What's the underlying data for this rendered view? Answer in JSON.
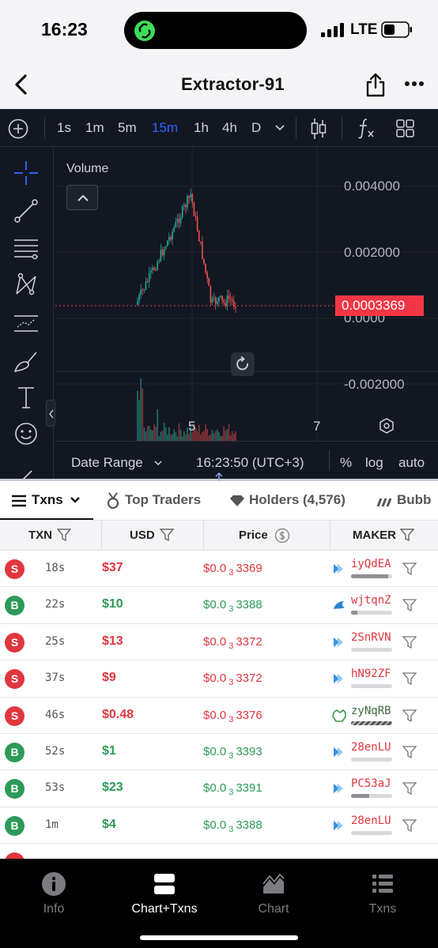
{
  "status": {
    "time": "16:23",
    "network": "LTE"
  },
  "header": {
    "title": "Extractor-91"
  },
  "toolbar": {
    "intervals": [
      "1s",
      "1m",
      "5m",
      "15m",
      "1h",
      "4h",
      "D"
    ],
    "active_interval": "15m"
  },
  "chart": {
    "panel_label": "Volume",
    "y_labels": [
      "0.004000",
      "0.002000",
      "0.0000",
      "-0.002000"
    ],
    "last_price": "0.0003369",
    "x_labels": [
      "5",
      "7"
    ],
    "date_range_label": "Date Range",
    "clock": "16:23:50 (UTC+3)",
    "percent_label": "%",
    "log_label": "log",
    "auto_label": "auto",
    "colors": {
      "up": "#26a69a",
      "down": "#ef5350",
      "price_line": "#f23645"
    }
  },
  "tabs": [
    {
      "label": "Txns"
    },
    {
      "label": "Top Traders"
    },
    {
      "label": "Holders (4,576)"
    },
    {
      "label": "Bubb"
    }
  ],
  "table": {
    "headers": {
      "txn": "TXN",
      "usd": "USD",
      "price": "Price",
      "maker": "MAKER"
    },
    "rows": [
      {
        "type": "S",
        "age": "18s",
        "usd": "$37",
        "price_prefix": "$0.0",
        "price_sub": "3",
        "price_digits": "3369",
        "maker": "iyQdEA",
        "icon": "blue",
        "bar": 0.9
      },
      {
        "type": "B",
        "age": "22s",
        "usd": "$10",
        "price_prefix": "$0.0",
        "price_sub": "3",
        "price_digits": "3388",
        "maker": "wjtqnZ",
        "icon": "bird",
        "bar": 0.15
      },
      {
        "type": "S",
        "age": "25s",
        "usd": "$13",
        "price_prefix": "$0.0",
        "price_sub": "3",
        "price_digits": "3372",
        "maker": "2SnRVN",
        "icon": "blue",
        "bar": 0.0
      },
      {
        "type": "S",
        "age": "37s",
        "usd": "$9",
        "price_prefix": "$0.0",
        "price_sub": "3",
        "price_digits": "3372",
        "maker": "hN92ZF",
        "icon": "blue",
        "bar": 0.0
      },
      {
        "type": "S",
        "age": "46s",
        "usd": "$0.48",
        "price_prefix": "$0.0",
        "price_sub": "3",
        "price_digits": "3376",
        "maker": "zyNqRB",
        "icon": "green",
        "bar": 1.0
      },
      {
        "type": "B",
        "age": "52s",
        "usd": "$1",
        "price_prefix": "$0.0",
        "price_sub": "3",
        "price_digits": "3393",
        "maker": "28enLU",
        "icon": "blue",
        "bar": 0.0
      },
      {
        "type": "B",
        "age": "53s",
        "usd": "$23",
        "price_prefix": "$0.0",
        "price_sub": "3",
        "price_digits": "3391",
        "maker": "PC53aJ",
        "icon": "blue",
        "bar": 0.45
      },
      {
        "type": "B",
        "age": "1m",
        "usd": "$4",
        "price_prefix": "$0.0",
        "price_sub": "3",
        "price_digits": "3388",
        "maker": "28enLU",
        "icon": "blue",
        "bar": 0.0
      }
    ]
  },
  "bottom_nav": [
    {
      "label": "Info",
      "icon": "info-icon"
    },
    {
      "label": "Chart+Txns",
      "icon": "split-view-icon"
    },
    {
      "label": "Chart",
      "icon": "area-chart-icon"
    },
    {
      "label": "Txns",
      "icon": "list-icon"
    }
  ]
}
